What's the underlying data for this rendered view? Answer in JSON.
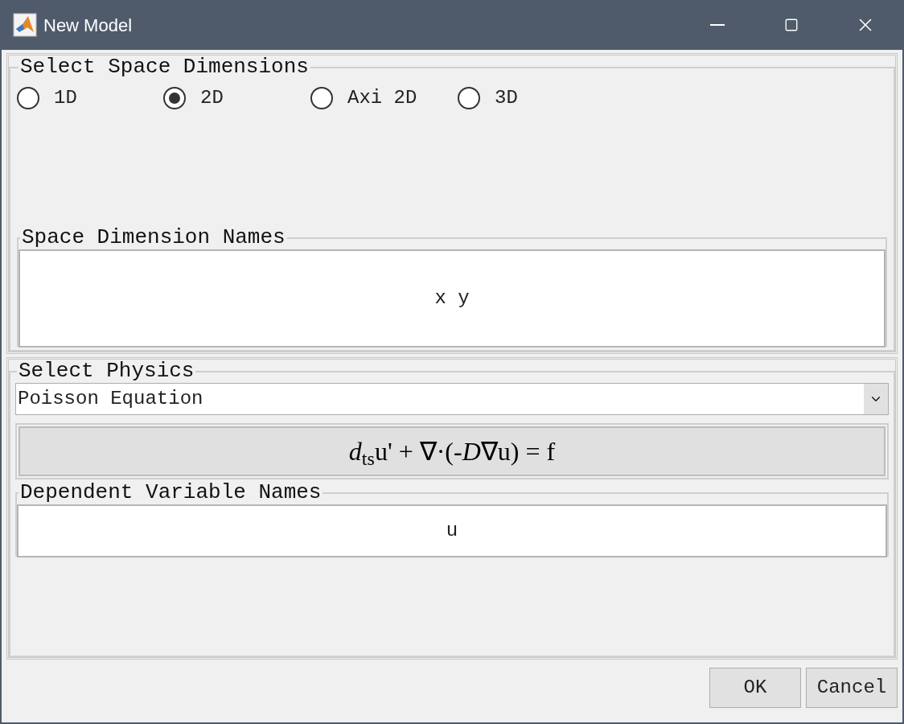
{
  "window": {
    "title": "New Model"
  },
  "space_dimensions": {
    "title": "Select Space Dimensions",
    "options": [
      {
        "label": "1D",
        "selected": false
      },
      {
        "label": "2D",
        "selected": true
      },
      {
        "label": "Axi 2D",
        "selected": false
      },
      {
        "label": "3D",
        "selected": false
      }
    ]
  },
  "space_dimension_names": {
    "title": "Space Dimension Names",
    "value": "x y"
  },
  "physics": {
    "title": "Select Physics",
    "value": "Poisson Equation",
    "equation": "*d*$_{ts}$u' + ∇·(-*D*∇u) = f"
  },
  "dependent_variable_names": {
    "title": "Dependent Variable Names",
    "value": "u"
  },
  "buttons": [
    "OK",
    "Cancel"
  ]
}
